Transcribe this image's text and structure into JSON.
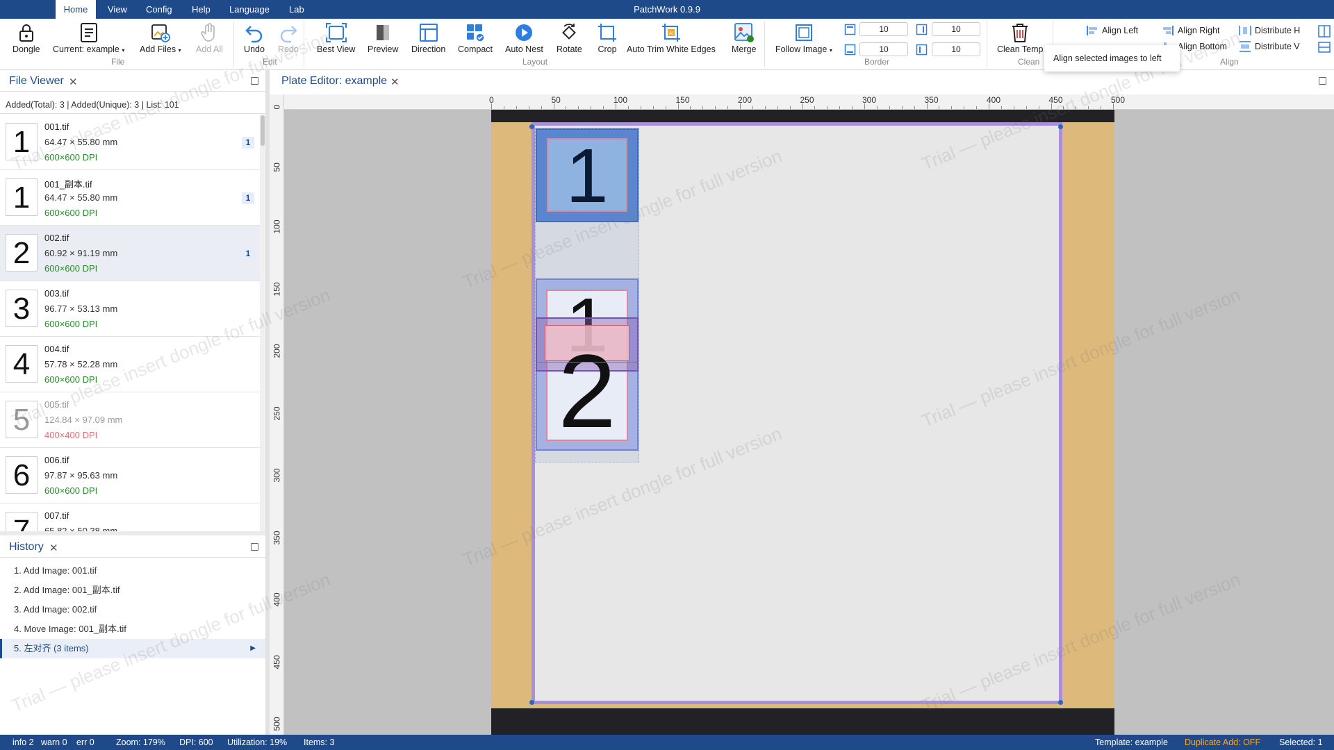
{
  "app": {
    "title": "PatchWork 0.9.9",
    "menus": [
      "Home",
      "View",
      "Config",
      "Help",
      "Language",
      "Lab"
    ]
  },
  "ribbon": {
    "file": {
      "dongle": "Dongle",
      "current": "Current: example",
      "add_files": "Add Files",
      "add_all": "Add All",
      "group": "File"
    },
    "edit": {
      "undo": "Undo",
      "redo": "Redo",
      "group": "Edit"
    },
    "layout": {
      "best_view": "Best View",
      "preview": "Preview",
      "direction": "Direction",
      "compact": "Compact",
      "auto_nest": "Auto Nest",
      "rotate": "Rotate",
      "crop": "Crop",
      "auto_trim": "Auto Trim White Edges",
      "merge": "Merge",
      "group": "Layout"
    },
    "border": {
      "follow_image": "Follow Image",
      "top": "10",
      "right": "10",
      "bottom": "10",
      "left": "10",
      "group": "Border"
    },
    "clean": {
      "clean_temp": "Clean Temp",
      "group": "Clean"
    },
    "align": {
      "align_left": "Align Left",
      "align_right": "Align Right",
      "align_bottom": "Align Bottom",
      "distribute_h": "Distribute H",
      "distribute_v": "Distribute V",
      "group": "Align"
    }
  },
  "tooltip": "Align selected images to left",
  "file_viewer": {
    "title": "File Viewer",
    "status": "Added(Total): 3 | Added(Unique): 3 | List: 101",
    "files": [
      {
        "thumb": "1",
        "name": "001.tif",
        "size": "64.47 × 55.80 mm",
        "dpi": "600×600 DPI",
        "count": "1"
      },
      {
        "thumb": "1",
        "name": "001_副本.tif",
        "size": "64.47 × 55.80 mm",
        "dpi": "600×600 DPI",
        "count": "1"
      },
      {
        "thumb": "2",
        "name": "002.tif",
        "size": "60.92 × 91.19 mm",
        "dpi": "600×600 DPI",
        "count": "1"
      },
      {
        "thumb": "3",
        "name": "003.tif",
        "size": "96.77 × 53.13 mm",
        "dpi": "600×600 DPI",
        "count": ""
      },
      {
        "thumb": "4",
        "name": "004.tif",
        "size": "57.78 × 52.28 mm",
        "dpi": "600×600 DPI",
        "count": ""
      },
      {
        "thumb": "5",
        "name": "005.tif",
        "size": "124.84 × 97.09 mm",
        "dpi": "400×400 DPI",
        "count": ""
      },
      {
        "thumb": "6",
        "name": "006.tif",
        "size": "97.87 × 95.63 mm",
        "dpi": "600×600 DPI",
        "count": ""
      },
      {
        "thumb": "7",
        "name": "007.tif",
        "size": "65.82 × 50.38 mm",
        "dpi": "600×600 DPI",
        "count": ""
      }
    ]
  },
  "history": {
    "title": "History",
    "items": [
      "1. Add Image: 001.tif",
      "2. Add Image: 001_副本.tif",
      "3. Add Image: 002.tif",
      "4. Move Image: 001_副本.tif",
      "5. 左对齐 (3 items)"
    ],
    "current_marker": "▶"
  },
  "editor": {
    "title": "Plate Editor: example",
    "ruler_x": [
      "0",
      "50",
      "100",
      "150",
      "200",
      "250",
      "300",
      "350",
      "400",
      "450",
      "500"
    ],
    "ruler_y": [
      "0",
      "50",
      "100",
      "150",
      "200",
      "250",
      "300",
      "350",
      "400",
      "450",
      "500"
    ],
    "tile_labels": [
      "1",
      "1",
      "2"
    ]
  },
  "status": {
    "info": "info 2",
    "warn": "warn 0",
    "err": "err 0",
    "zoom": "Zoom: 179%",
    "dpi": "DPI: 600",
    "utilization": "Utilization: 19%",
    "items": "Items: 3",
    "template": "Template: example",
    "duplicate": "Duplicate Add: OFF",
    "selected": "Selected: 1"
  },
  "watermark": "Trial — please insert dongle for full version",
  "colors": {
    "brand": "#1f4a8a",
    "accent_blue": "#2e7de0",
    "dpi_ok": "#2a8a2a",
    "dpi_low": "#e07070",
    "duplicate_off": "#ffa726",
    "plate_bar": "#222226",
    "margin": "#ddb97c",
    "border_purple": "#a88fd6"
  }
}
